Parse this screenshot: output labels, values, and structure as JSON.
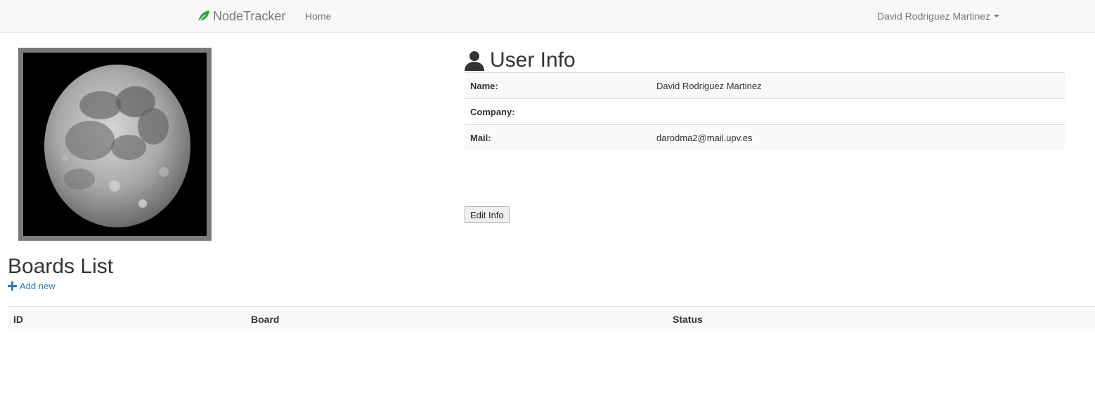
{
  "navbar": {
    "brand": "NodeTracker",
    "brand_icon": "leaf-icon",
    "home_label": "Home",
    "user_name": "David Rodriguez Martinez"
  },
  "avatar": {
    "description_icon": "moon-image"
  },
  "user_info": {
    "title": "User Info",
    "rows": [
      {
        "label": "Name:",
        "value": "David Rodriguez Martinez"
      },
      {
        "label": "Company:",
        "value": ""
      },
      {
        "label": "Mail:",
        "value": "darodma2@mail.upv.es"
      }
    ],
    "edit_label": "Edit Info"
  },
  "boards": {
    "title": "Boards List",
    "add_label": "Add new",
    "columns": [
      "ID",
      "Board",
      "Status"
    ],
    "rows": []
  },
  "colors": {
    "brand_leaf": "#2ea043",
    "link": "#337ab7",
    "navbar_bg": "#f8f8f8"
  }
}
